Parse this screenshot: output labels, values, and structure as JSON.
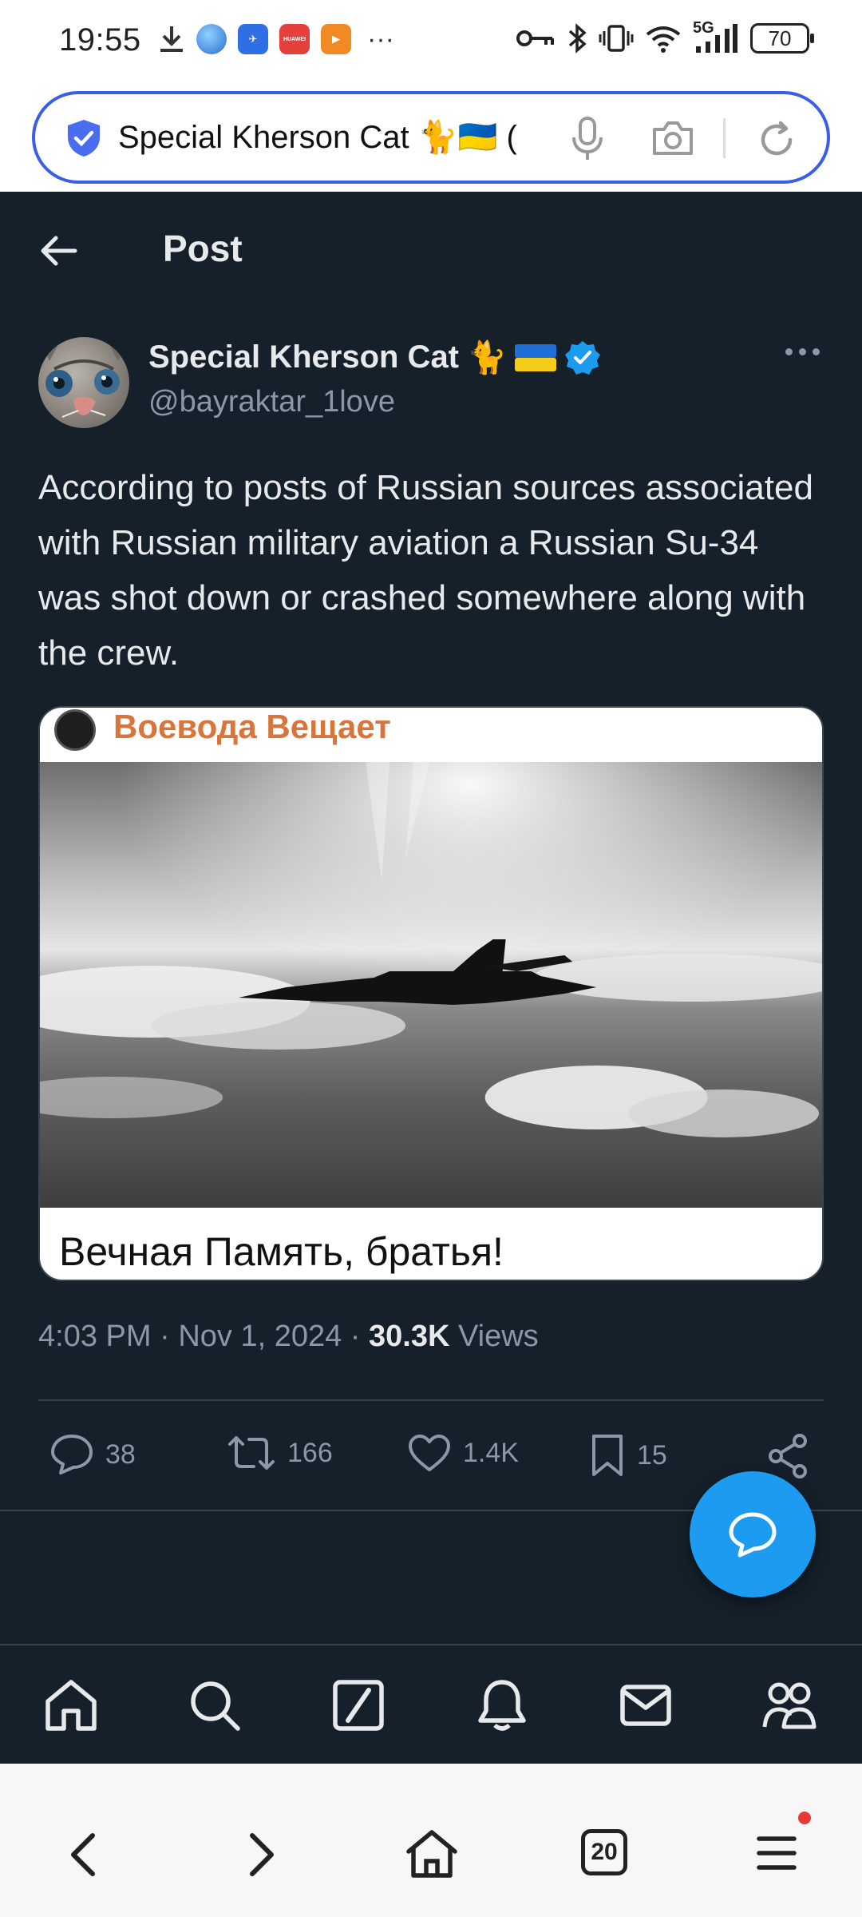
{
  "status_bar": {
    "time": "19:55",
    "network": "5G",
    "battery": "70",
    "app_icons": [
      "download-icon",
      "browser-app-icon",
      "tmall-app-icon",
      "huawei-app-icon",
      "video-app-icon"
    ],
    "huawei_label": "HUAWEI",
    "more": "···"
  },
  "browser": {
    "url_text": "Special Kherson Cat 🐈🇺🇦 (",
    "tabs_count": "20"
  },
  "header": {
    "title": "Post"
  },
  "author": {
    "name": "Special Kherson Cat",
    "name_emoji": "🐈",
    "handle": "@bayraktar_1love",
    "verified": true
  },
  "tweet": {
    "text": "According to posts of Russian sources associated with Russian military aviation a Russian Su-34 was shot down or crashed somewhere along with the crew.",
    "media": {
      "channel_name": "Воевода Вещает",
      "caption": "Вечная Память, братья!"
    },
    "time": "4:03 PM",
    "date": "Nov 1, 2024",
    "views_count": "30.3K",
    "views_label": "Views"
  },
  "actions": {
    "replies": "38",
    "reposts": "166",
    "likes": "1.4K",
    "bookmarks": "15"
  },
  "colors": {
    "background": "#15202b",
    "text": "#e7e9ea",
    "muted": "#8b98a5",
    "accent": "#1d9bf0",
    "divider": "#38444d",
    "url_border": "#3a5ee6"
  }
}
